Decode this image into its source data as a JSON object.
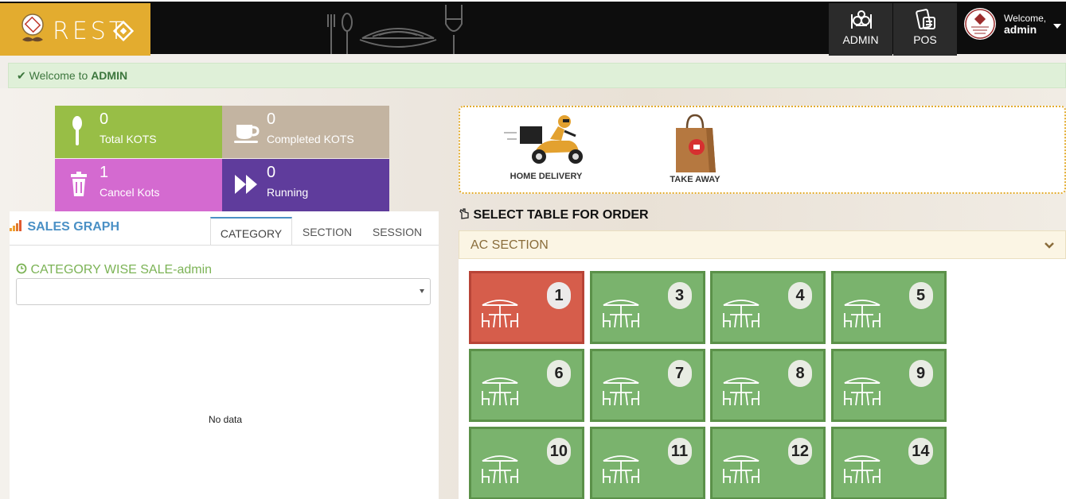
{
  "header": {
    "logo_text": "REST",
    "nav": [
      {
        "label": "ADMIN",
        "icon": "chef-icon"
      },
      {
        "label": "POS",
        "icon": "pos-icon"
      }
    ],
    "user": {
      "welcome": "Welcome,",
      "name": "admin"
    }
  },
  "alert": {
    "prefix": "Welcome to",
    "highlight": "ADMIN"
  },
  "stats": [
    {
      "value": "0",
      "label": "Total KOTS",
      "color": "#98be46",
      "icon": "spoon-icon"
    },
    {
      "value": "0",
      "label": "Completed KOTS",
      "color": "#c3b4a1",
      "icon": "coffee-cup-icon"
    },
    {
      "value": "1",
      "label": "Cancel Kots",
      "color": "#d46ad0",
      "icon": "trash-icon"
    },
    {
      "value": "0",
      "label": "Running",
      "color": "#5f3c9c",
      "icon": "fast-forward-icon"
    }
  ],
  "sales": {
    "title": "SALES GRAPH",
    "tabs": [
      "CATEGORY",
      "SECTION",
      "SESSION"
    ],
    "active_tab": "CATEGORY",
    "subtitle": "CATEGORY WISE SALE-admin",
    "select_value": "",
    "empty_text": "No data"
  },
  "order_types": [
    {
      "label": "HOME DELIVERY",
      "icon": "delivery-scooter-icon"
    },
    {
      "label": "TAKE AWAY",
      "icon": "shopping-bag-icon"
    }
  ],
  "tables": {
    "title": "SELECT TABLE FOR ORDER",
    "section": "AC SECTION",
    "items": [
      {
        "no": "1",
        "status": "occupied"
      },
      {
        "no": "3",
        "status": "free"
      },
      {
        "no": "4",
        "status": "free"
      },
      {
        "no": "5",
        "status": "free"
      },
      {
        "no": "6",
        "status": "free"
      },
      {
        "no": "7",
        "status": "free"
      },
      {
        "no": "8",
        "status": "free"
      },
      {
        "no": "9",
        "status": "free"
      },
      {
        "no": "10",
        "status": "free"
      },
      {
        "no": "11",
        "status": "free"
      },
      {
        "no": "12",
        "status": "free"
      },
      {
        "no": "14",
        "status": "free"
      }
    ]
  },
  "colors": {
    "brand": "#e3ac2f",
    "table_free": "#7ab36d",
    "table_occupied": "#d65d4b",
    "link_blue": "#4a90c5",
    "success_green": "#3c763d"
  }
}
